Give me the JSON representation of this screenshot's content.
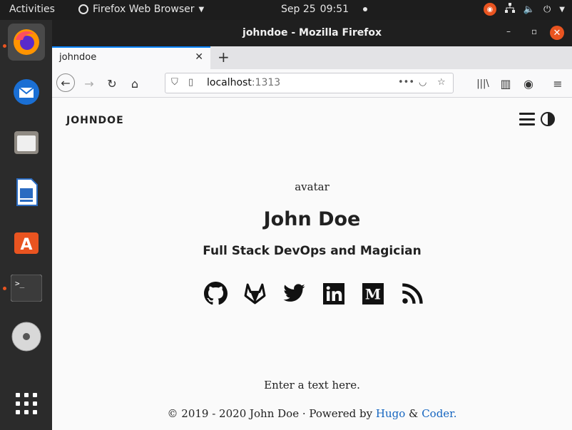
{
  "topbar": {
    "activities": "Activities",
    "app_name": "Firefox Web Browser",
    "date": "Sep 25",
    "time": "09:51"
  },
  "window": {
    "title": "johndoe - Mozilla Firefox"
  },
  "tab": {
    "title": "johndoe"
  },
  "url": {
    "host": "localhost",
    "port": ":1313"
  },
  "site": {
    "brand": "JOHNDOE",
    "avatar_alt": "avatar",
    "name": "John Doe",
    "subtitle": "Full Stack DevOps and Magician",
    "social": [
      "github-icon",
      "gitlab-icon",
      "twitter-icon",
      "linkedin-icon",
      "medium-icon",
      "rss-icon"
    ],
    "footer_text": "Enter a text here.",
    "copyright_prefix": "© 2019 - 2020 John Doe · Powered by",
    "link_hugo": "Hugo",
    "amp": "&",
    "link_coder": "Coder",
    "period": "."
  },
  "colors": {
    "accent": "#e95420",
    "link": "#1565c0",
    "tab_accent": "#0a84ff"
  }
}
